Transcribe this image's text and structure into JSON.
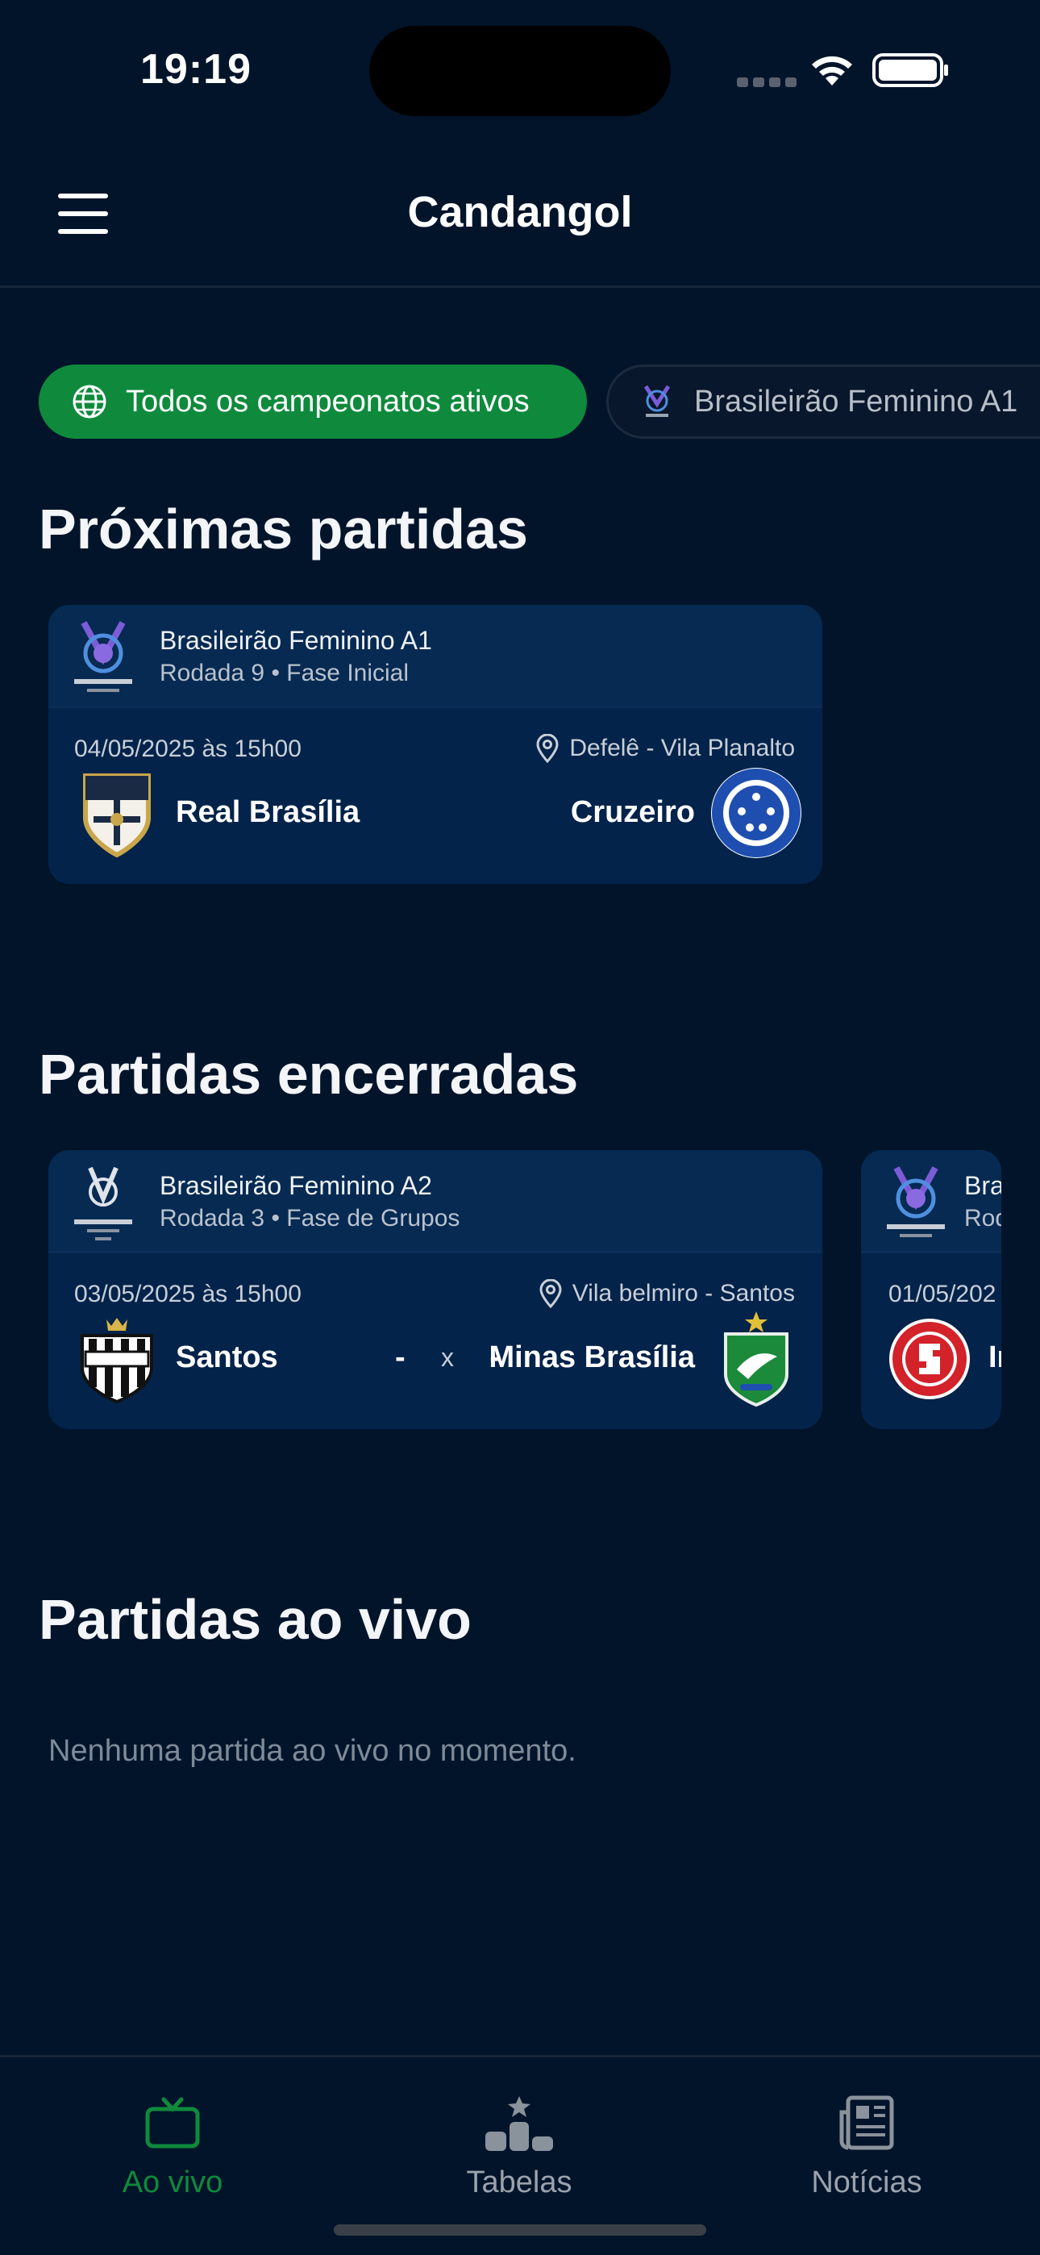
{
  "status_bar": {
    "time": "19:19"
  },
  "header": {
    "title": "Candangol"
  },
  "filters": {
    "active_label": "Todos os campeonatos ativos",
    "second_label": "Brasileirão Feminino A1"
  },
  "upcoming": {
    "title": "Próximas partidas",
    "matches": [
      {
        "championship": "Brasileirão Feminino A1",
        "round": "Rodada 9",
        "phase": "Fase Inicial",
        "datetime": "04/05/2025 às 15h00",
        "venue": "Defelê - Vila Planalto",
        "home_team": "Real Brasília",
        "away_team": "Cruzeiro"
      }
    ]
  },
  "finished": {
    "title": "Partidas encerradas",
    "matches": [
      {
        "championship": "Brasileirão Feminino A2",
        "round": "Rodada 3",
        "phase": "Fase de Grupos",
        "datetime": "03/05/2025 às 15h00",
        "venue": "Vila belmiro - Santos",
        "home_team": "Santos",
        "away_team": "Minas Brasília",
        "home_score": "-",
        "separator": "x",
        "away_score": "-"
      },
      {
        "championship": "Bra",
        "round": "Rod",
        "datetime": "01/05/202",
        "home_team": "In"
      }
    ]
  },
  "live": {
    "title": "Partidas ao vivo",
    "empty_message": "Nenhuma partida ao vivo no momento."
  },
  "bottom_nav": {
    "items": [
      {
        "label": "Ao vivo",
        "icon": "tv-icon",
        "active": true
      },
      {
        "label": "Tabelas",
        "icon": "podium-icon",
        "active": false
      },
      {
        "label": "Notícias",
        "icon": "newspaper-icon",
        "active": false
      }
    ]
  },
  "colors": {
    "background": "#01142a",
    "card": "#03234a",
    "accent_green": "#0f8a3c",
    "muted_text": "#7f8a98"
  }
}
